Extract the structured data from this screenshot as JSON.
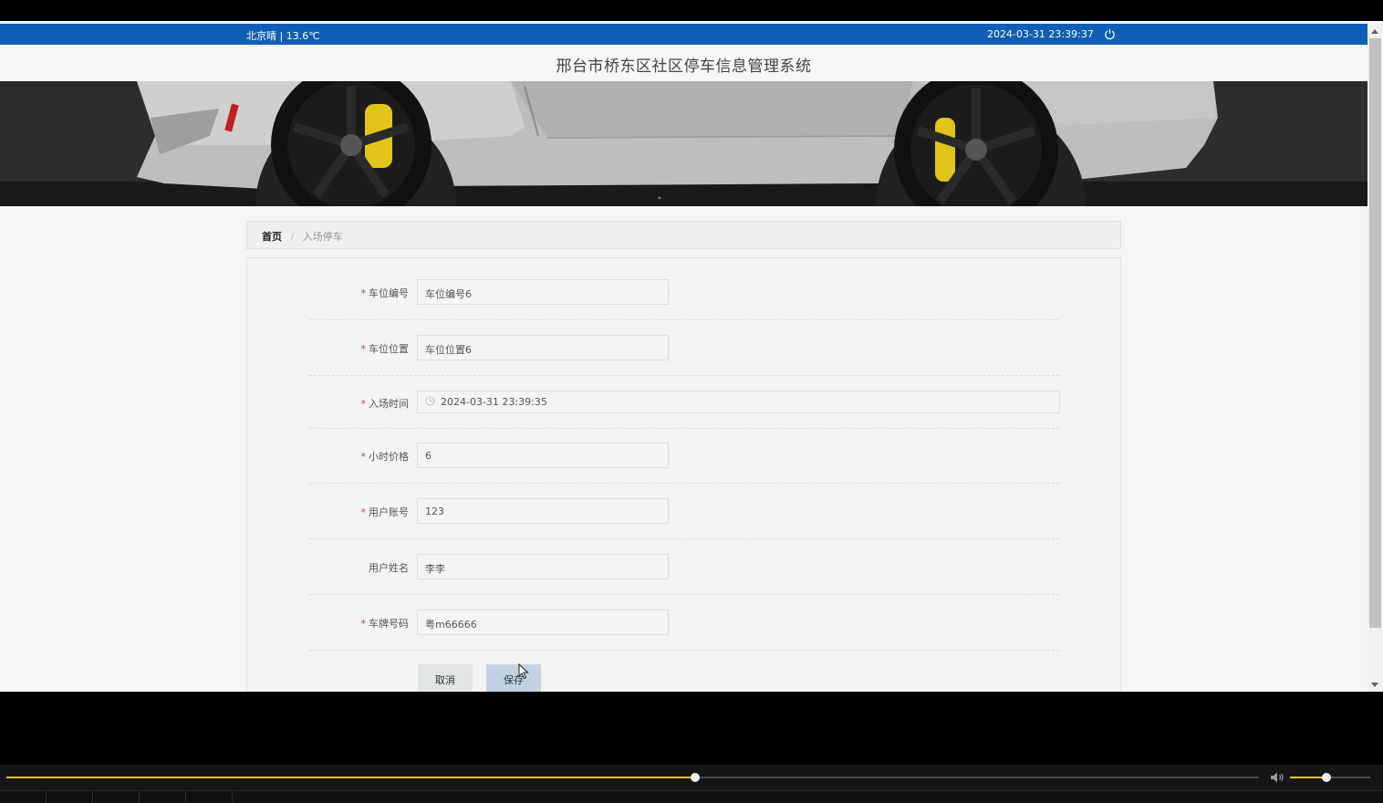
{
  "header": {
    "weather": "北京晴 | 13.6℃",
    "datetime": "2024-03-31   23:39:37",
    "title": "邢台市桥东区社区停车信息管理系统"
  },
  "breadcrumb": {
    "home": "首页",
    "separator": "/",
    "current": "入场停车"
  },
  "form": {
    "fields": [
      {
        "label": "车位编号",
        "required": "*",
        "value": "车位编号6"
      },
      {
        "label": "车位位置",
        "required": "*",
        "value": "车位位置6"
      },
      {
        "label": "入场时间",
        "required": "*",
        "value": "2024-03-31 23:39:35"
      },
      {
        "label": "小时价格",
        "required": "*",
        "value": "6"
      },
      {
        "label": "用户账号",
        "required": "*",
        "value": "123"
      },
      {
        "label": "用户姓名",
        "required": "",
        "value": "李李"
      },
      {
        "label": "车牌号码",
        "required": "*",
        "value": "粤m66666"
      }
    ],
    "cancel_label": "取消",
    "save_label": "保存"
  },
  "player": {
    "seek_fraction": 0.55,
    "volume_fraction": 0.45,
    "accent_color": "#e6c318"
  },
  "icons": {
    "power": "power-icon",
    "clock": "clock-icon",
    "volume": "volume-icon"
  },
  "colors": {
    "topbar": "#0f5eb5",
    "required_star": "#e4393c",
    "save_button": "#c3d2e0"
  }
}
